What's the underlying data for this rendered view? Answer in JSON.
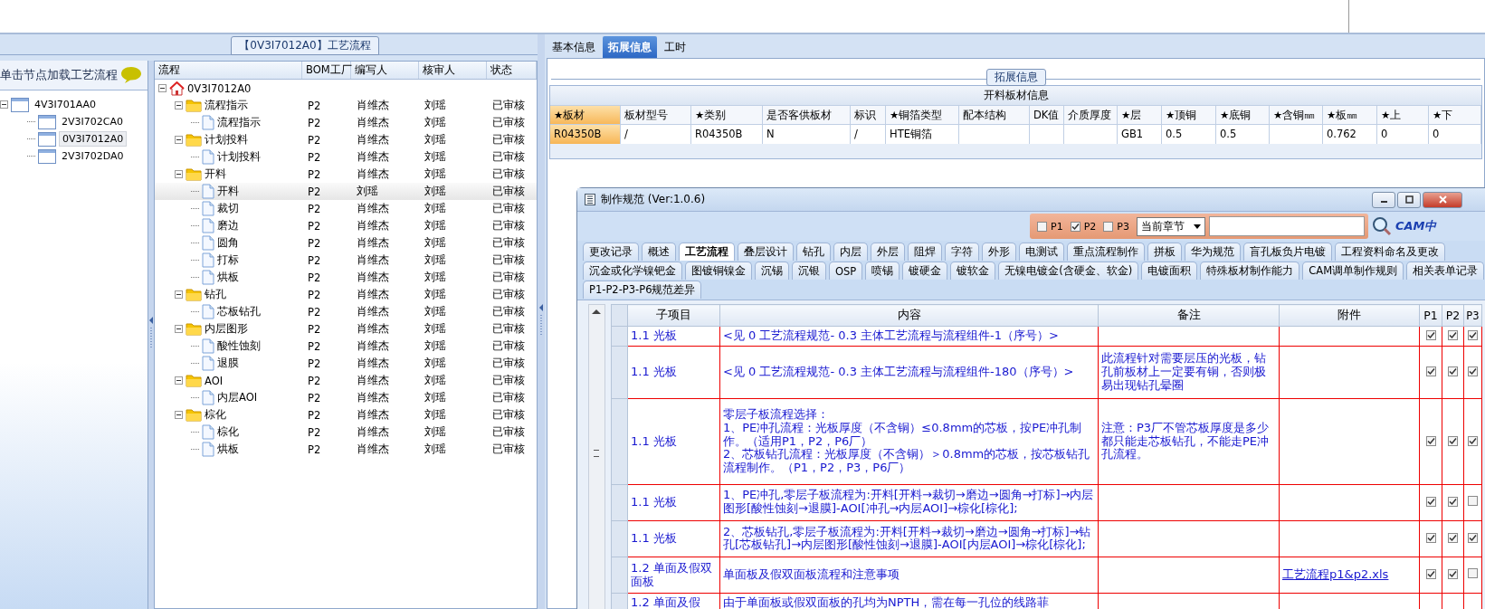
{
  "left_panel": {
    "title": "【0V3I7012A0】工艺流程",
    "hint": "单击节点加载工艺流程",
    "tree": [
      {
        "label": "4V3I701AA0",
        "expanded": true,
        "selected": false,
        "children": [
          {
            "label": "2V3I702CA0",
            "selected": false
          },
          {
            "label": "0V3I7012A0",
            "selected": true
          },
          {
            "label": "2V3I702DA0",
            "selected": false
          }
        ]
      }
    ]
  },
  "flow_grid": {
    "columns": [
      "流程",
      "BOM工厂",
      "编写人",
      "核审人",
      "状态"
    ],
    "rows": [
      {
        "kind": "root",
        "label": "0V3I7012A0",
        "expanded": true,
        "selected": false,
        "children": [
          {
            "kind": "group",
            "label": "流程指示",
            "factory": "P2",
            "author": "肖维杰",
            "reviewer": "刘瑶",
            "status": "已审核",
            "expanded": true,
            "selected": false,
            "children": [
              {
                "kind": "step",
                "label": "流程指示",
                "factory": "P2",
                "author": "肖维杰",
                "reviewer": "刘瑶",
                "status": "已审核",
                "selected": false
              }
            ]
          },
          {
            "kind": "group",
            "label": "计划投料",
            "factory": "P2",
            "author": "肖维杰",
            "reviewer": "刘瑶",
            "status": "已审核",
            "expanded": true,
            "selected": false,
            "children": [
              {
                "kind": "step",
                "label": "计划投料",
                "factory": "P2",
                "author": "肖维杰",
                "reviewer": "刘瑶",
                "status": "已审核",
                "selected": false
              }
            ]
          },
          {
            "kind": "group",
            "label": "开料",
            "factory": "P2",
            "author": "肖维杰",
            "reviewer": "刘瑶",
            "status": "已审核",
            "expanded": true,
            "selected": false,
            "children": [
              {
                "kind": "step",
                "label": "开料",
                "factory": "P2",
                "author": "刘瑶",
                "reviewer": "刘瑶",
                "status": "已审核",
                "selected": true
              },
              {
                "kind": "step",
                "label": "裁切",
                "factory": "P2",
                "author": "肖维杰",
                "reviewer": "刘瑶",
                "status": "已审核",
                "selected": false
              },
              {
                "kind": "step",
                "label": "磨边",
                "factory": "P2",
                "author": "肖维杰",
                "reviewer": "刘瑶",
                "status": "已审核",
                "selected": false
              },
              {
                "kind": "step",
                "label": "圆角",
                "factory": "P2",
                "author": "肖维杰",
                "reviewer": "刘瑶",
                "status": "已审核",
                "selected": false
              },
              {
                "kind": "step",
                "label": "打标",
                "factory": "P2",
                "author": "肖维杰",
                "reviewer": "刘瑶",
                "status": "已审核",
                "selected": false
              },
              {
                "kind": "step",
                "label": "烘板",
                "factory": "P2",
                "author": "肖维杰",
                "reviewer": "刘瑶",
                "status": "已审核",
                "selected": false
              }
            ]
          },
          {
            "kind": "group",
            "label": "钻孔",
            "factory": "P2",
            "author": "肖维杰",
            "reviewer": "刘瑶",
            "status": "已审核",
            "expanded": true,
            "selected": false,
            "children": [
              {
                "kind": "step",
                "label": "芯板钻孔",
                "factory": "P2",
                "author": "肖维杰",
                "reviewer": "刘瑶",
                "status": "已审核",
                "selected": false
              }
            ]
          },
          {
            "kind": "group",
            "label": "内层图形",
            "factory": "P2",
            "author": "肖维杰",
            "reviewer": "刘瑶",
            "status": "已审核",
            "expanded": true,
            "selected": false,
            "children": [
              {
                "kind": "step",
                "label": "酸性蚀刻",
                "factory": "P2",
                "author": "肖维杰",
                "reviewer": "刘瑶",
                "status": "已审核",
                "selected": false
              },
              {
                "kind": "step",
                "label": "退膜",
                "factory": "P2",
                "author": "肖维杰",
                "reviewer": "刘瑶",
                "status": "已审核",
                "selected": false
              }
            ]
          },
          {
            "kind": "group",
            "label": "AOI",
            "factory": "P2",
            "author": "肖维杰",
            "reviewer": "刘瑶",
            "status": "已审核",
            "expanded": true,
            "selected": false,
            "children": [
              {
                "kind": "step",
                "label": "内层AOI",
                "factory": "P2",
                "author": "肖维杰",
                "reviewer": "刘瑶",
                "status": "已审核",
                "selected": false
              }
            ]
          },
          {
            "kind": "group",
            "label": "棕化",
            "factory": "P2",
            "author": "肖维杰",
            "reviewer": "刘瑶",
            "status": "已审核",
            "expanded": true,
            "selected": false,
            "children": [
              {
                "kind": "step",
                "label": "棕化",
                "factory": "P2",
                "author": "肖维杰",
                "reviewer": "刘瑶",
                "status": "已审核",
                "selected": false
              },
              {
                "kind": "step",
                "label": "烘板",
                "factory": "P2",
                "author": "肖维杰",
                "reviewer": "刘瑶",
                "status": "已审核",
                "selected": false
              }
            ]
          }
        ]
      }
    ]
  },
  "right_panel": {
    "tabs": [
      {
        "label": "基本信息",
        "selected": false
      },
      {
        "label": "拓展信息",
        "selected": true
      },
      {
        "label": "工时",
        "selected": false
      }
    ],
    "section_title": "拓展信息",
    "material_table": {
      "title": "开料板材信息",
      "columns": [
        {
          "label": "★板材",
          "selected": true
        },
        {
          "label": "板材型号",
          "selected": false
        },
        {
          "label": "★类别",
          "selected": false
        },
        {
          "label": "是否客供板材",
          "selected": false
        },
        {
          "label": "标识",
          "selected": false
        },
        {
          "label": "★铜箔类型",
          "selected": false
        },
        {
          "label": "配本结构",
          "selected": false
        },
        {
          "label": "DK值",
          "selected": false
        },
        {
          "label": "介质厚度",
          "selected": false
        },
        {
          "label": "★层",
          "selected": false
        },
        {
          "label": "★顶铜",
          "selected": false
        },
        {
          "label": "★底铜",
          "selected": false
        },
        {
          "label": "★含铜㎜",
          "selected": false
        },
        {
          "label": "★板㎜",
          "selected": false
        },
        {
          "label": "★上",
          "selected": false
        },
        {
          "label": "★下",
          "selected": false
        }
      ],
      "rows": [
        [
          "R04350B",
          "/",
          "R04350B",
          "N",
          "/",
          "HTE铜箔",
          "",
          "",
          "",
          "GB1",
          "0.5",
          "0.5",
          "",
          "0.762",
          "0",
          "0"
        ]
      ]
    }
  },
  "dialog": {
    "title": "制作规范 (Ver:1.0.6)",
    "filters": [
      {
        "label": "P1",
        "checked": false
      },
      {
        "label": "P2",
        "checked": true
      },
      {
        "label": "P3",
        "checked": false
      }
    ],
    "chapter_select": "当前章节",
    "logo": "CAM中",
    "tab_rows": [
      [
        {
          "label": "更改记录",
          "selected": false
        },
        {
          "label": "概述",
          "selected": false
        },
        {
          "label": "工艺流程",
          "selected": true
        },
        {
          "label": "叠层设计",
          "selected": false
        },
        {
          "label": "钻孔",
          "selected": false
        },
        {
          "label": "内层",
          "selected": false
        },
        {
          "label": "外层",
          "selected": false
        },
        {
          "label": "阻焊",
          "selected": false
        },
        {
          "label": "字符",
          "selected": false
        },
        {
          "label": "外形",
          "selected": false
        },
        {
          "label": "电测试",
          "selected": false
        },
        {
          "label": "重点流程制作",
          "selected": false
        },
        {
          "label": "拼板",
          "selected": false
        },
        {
          "label": "华为规范",
          "selected": false
        },
        {
          "label": "盲孔板负片电镀",
          "selected": false
        },
        {
          "label": "工程资料命名及更改",
          "selected": false
        }
      ],
      [
        {
          "label": "沉金或化学镍钯金",
          "selected": false
        },
        {
          "label": "图镀铜镍金",
          "selected": false
        },
        {
          "label": "沉锡",
          "selected": false
        },
        {
          "label": "沉银",
          "selected": false
        },
        {
          "label": "OSP",
          "selected": false
        },
        {
          "label": "喷锡",
          "selected": false
        },
        {
          "label": "镀硬金",
          "selected": false
        },
        {
          "label": "镀软金",
          "selected": false
        },
        {
          "label": "无镍电镀金(含硬金、软金)",
          "selected": false
        },
        {
          "label": "电镀面积",
          "selected": false
        },
        {
          "label": "特殊板材制作能力",
          "selected": false
        },
        {
          "label": "CAM调单制作规则",
          "selected": false
        },
        {
          "label": "相关表单记录",
          "selected": false
        }
      ],
      [
        {
          "label": "P1-P2-P3-P6规范差异",
          "selected": false
        }
      ]
    ],
    "table": {
      "columns": [
        "子项目",
        "内容",
        "备注",
        "附件",
        "P1",
        "P2",
        "P3"
      ],
      "rows": [
        {
          "item": "1.1 光板",
          "content": "<见 0 工艺流程规范- 0.3 主体工艺流程与流程组件-1（序号）>",
          "checks": [
            true,
            true,
            true
          ]
        },
        {
          "item": "1.1 光板",
          "content": "<见 0 工艺流程规范- 0.3 主体工艺流程与流程组件-180（序号）>",
          "note": "此流程针对需要层压的光板，钻孔前板材上一定要有铜，否则极易出现钻孔晕圈",
          "checks": [
            true,
            true,
            true
          ]
        },
        {
          "item": "1.1 光板",
          "content": "零层子板流程选择：\n1、PE冲孔流程：光板厚度（不含铜）≤0.8mm的芯板，按PE冲孔制作。（适用P1，P2，P6厂）\n2、芯板钻孔流程：光板厚度（不含铜）＞0.8mm的芯板，按芯板钻孔流程制作。（P1，P2，P3，P6厂）",
          "note": "注意：P3厂不管芯板厚度是多少都只能走芯板钻孔，不能走PE冲孔流程。",
          "checks": [
            true,
            true,
            true
          ]
        },
        {
          "item": "1.1 光板",
          "content": "1、PE冲孔,零层子板流程为:开料[开料→裁切→磨边→圆角→打标]→内层图形[酸性蚀刻→退膜]-AOI[冲孔→内层AOI]→棕化[棕化];",
          "checks": [
            true,
            true,
            false
          ]
        },
        {
          "item": "1.1 光板",
          "content": "2、芯板钻孔,零层子板流程为:开料[开料→裁切→磨边→圆角→打标]→钻孔[芯板钻孔]→内层图形[酸性蚀刻→退膜]-AOI[内层AOI]→棕化[棕化];",
          "checks": [
            true,
            true,
            true
          ]
        },
        {
          "item": "1.2 单面及假双面板",
          "content": "单面板及假双面板流程和注意事项",
          "attachment": "工艺流程p1&p2.xls",
          "checks": [
            true,
            true,
            false
          ]
        },
        {
          "item": "1.2 单面及假",
          "content": "由于单面板或假双面板的孔均为NPTH，需在每一孔位的线路菲"
        }
      ]
    }
  }
}
